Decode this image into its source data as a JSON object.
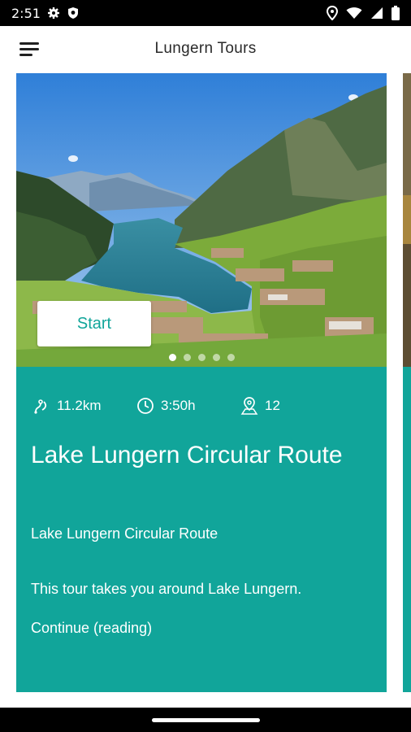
{
  "status_bar": {
    "time": "2:51",
    "left_icons": [
      "gear-icon",
      "shield-icon"
    ],
    "right_icons": [
      "location-icon",
      "wifi-icon",
      "cell-signal-icon",
      "battery-icon"
    ]
  },
  "app_bar": {
    "title": "Lungern Tours",
    "menu_icon": "hamburger-menu-icon"
  },
  "card": {
    "start_button": "Start",
    "carousel": {
      "pages": 5,
      "active_index": 0
    },
    "stats": {
      "distance": "11.2km",
      "duration": "3:50h",
      "stations": "12"
    },
    "title": "Lake Lungern Circular Route",
    "subtitle": "Lake Lungern Circular Route",
    "excerpt": "This tour takes you around Lake Lungern.",
    "continue_link": "Continue (reading)"
  },
  "colors": {
    "accent": "#11a59a",
    "status_bar": "#000000"
  }
}
